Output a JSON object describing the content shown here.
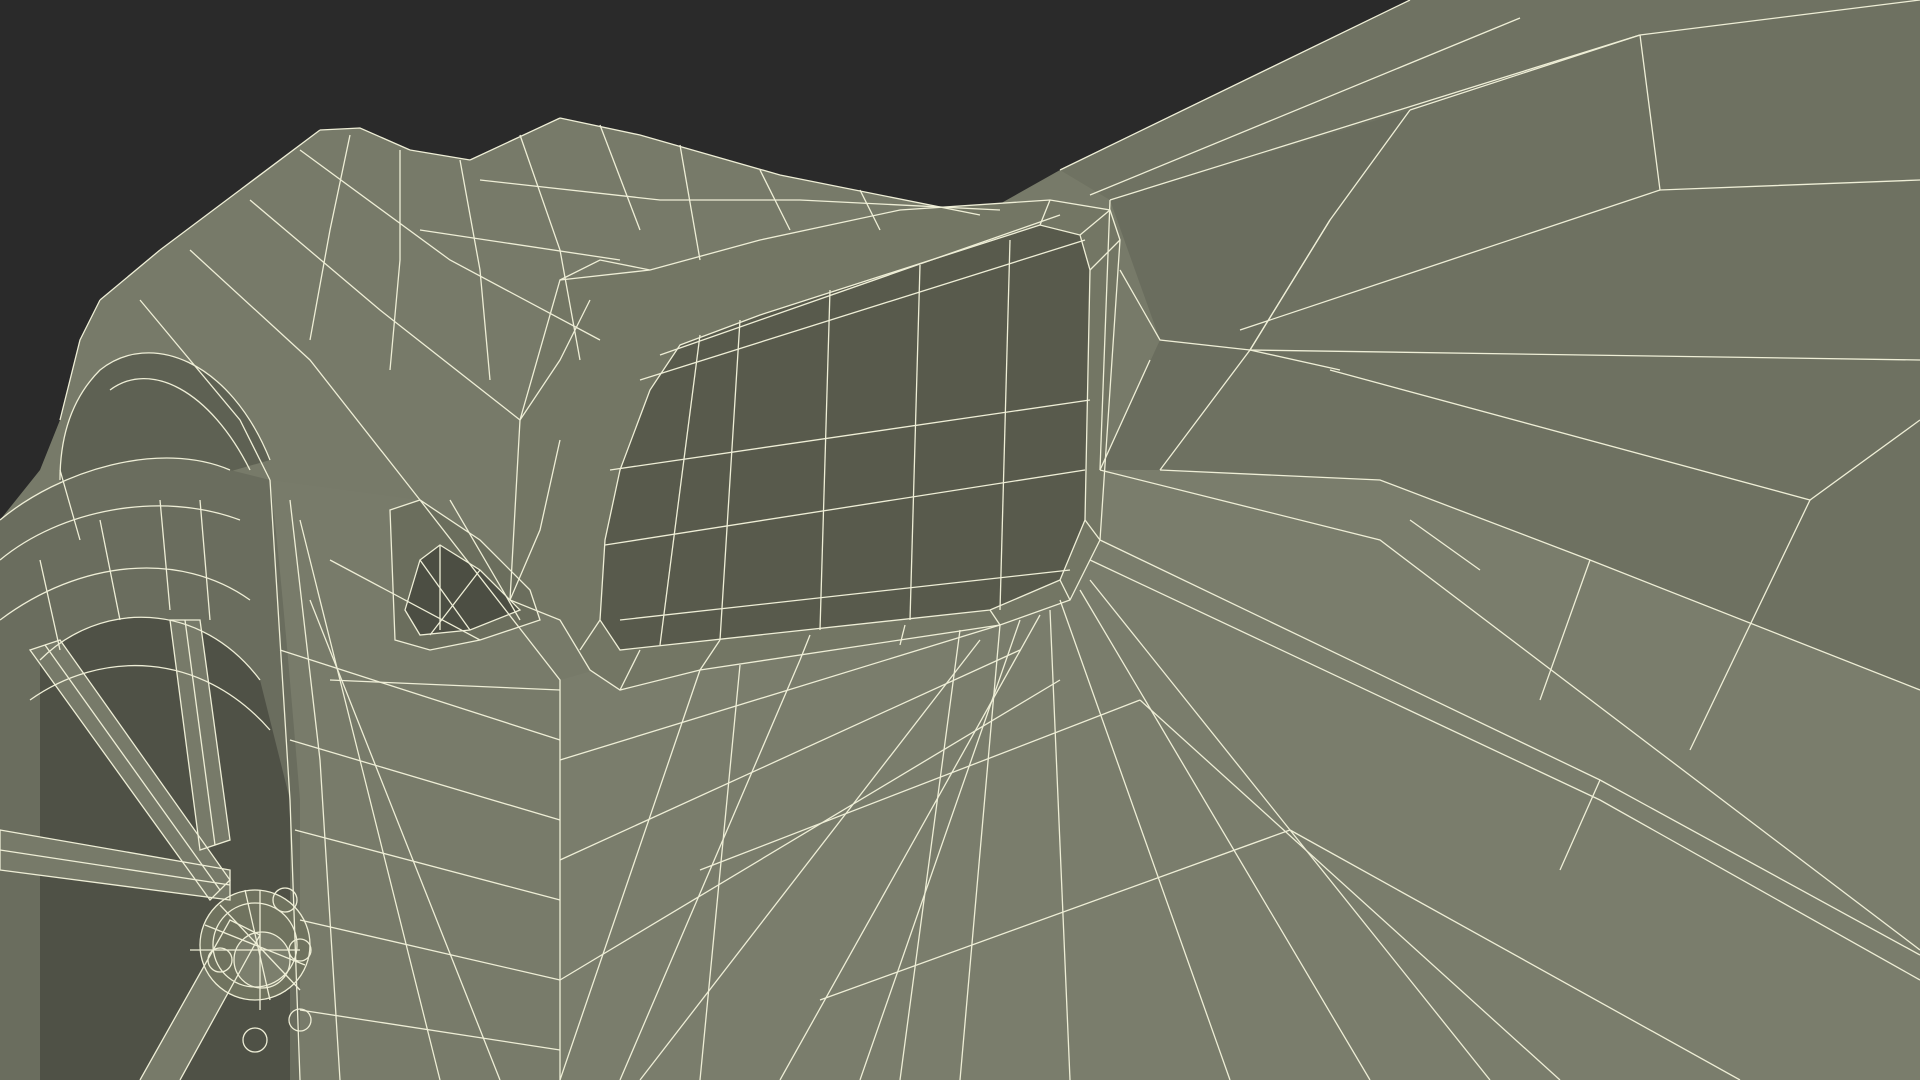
{
  "scene": {
    "subject": "car-side-mirror-wireframe",
    "background_color": "#2a2a2a",
    "surface_color": "#777a69",
    "surface_shadow_color": "#5f6254",
    "surface_dark_color": "#4c4e43",
    "wire_color": "#eeeed6"
  }
}
